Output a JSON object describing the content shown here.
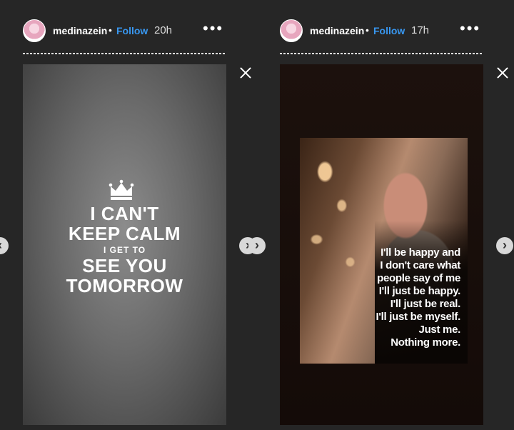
{
  "stories": [
    {
      "username": "medinazein",
      "separator": "•",
      "follow_label": "Follow",
      "time": "20h",
      "more_label": "•••",
      "content": {
        "line1": "I CAN'T",
        "line2": "KEEP CALM",
        "line3": "I GET TO",
        "line4": "SEE YOU",
        "line5": "TOMORROW"
      }
    },
    {
      "username": "medinazein",
      "separator": "•",
      "follow_label": "Follow",
      "time": "17h",
      "more_label": "•••",
      "quote_lines": [
        "I'll be happy and",
        "I don't care what",
        "people say of me",
        "I'll just be happy.",
        "I'll just be real.",
        "I'll just be myself.",
        "Just me.",
        "Nothing more."
      ]
    }
  ],
  "nav": {
    "prev_symbol": "‹",
    "next_symbol": "›"
  },
  "colors": {
    "background": "#262626",
    "follow": "#3897f0"
  },
  "icons": {
    "close": "close-icon",
    "crown": "crown-icon",
    "more": "more-options-icon"
  }
}
